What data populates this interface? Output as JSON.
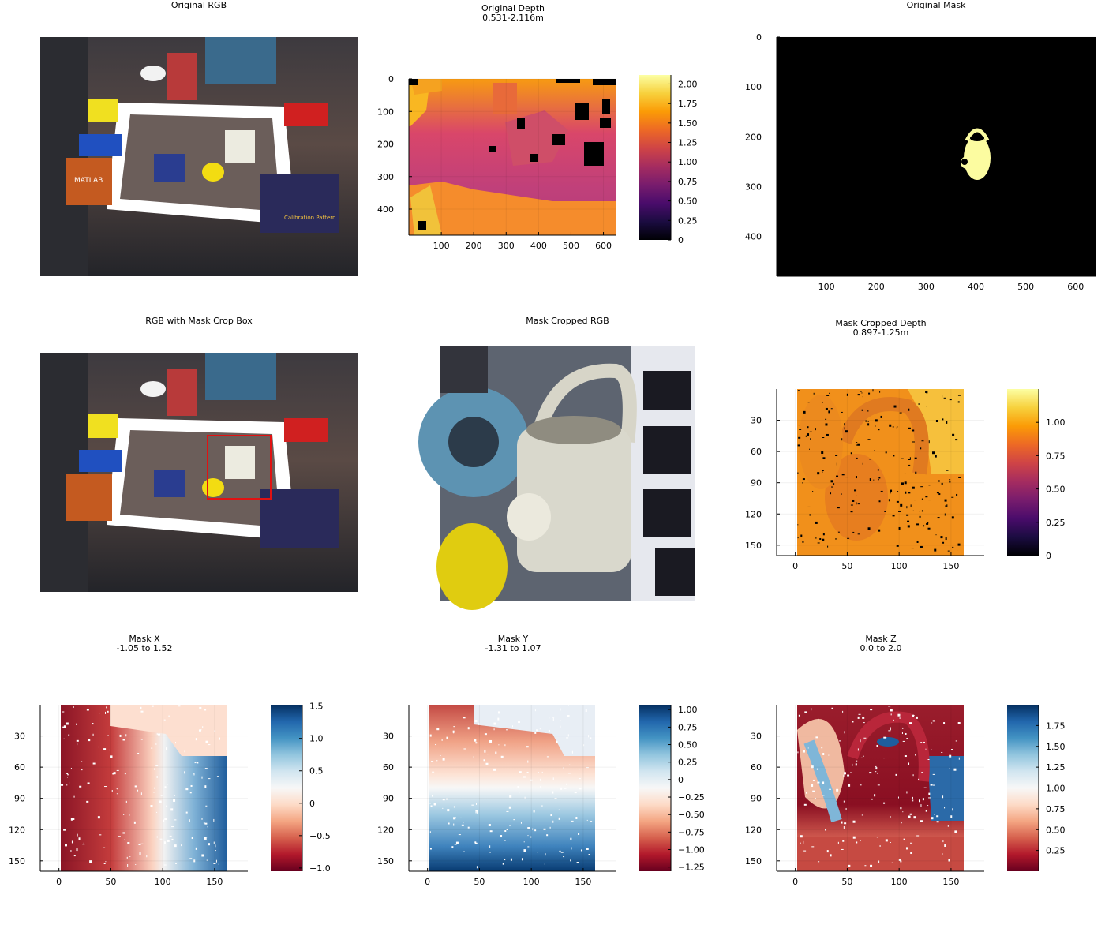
{
  "colors": {
    "crop_box": "#e11212",
    "mask_fg": "#fcfca0",
    "mask_bg": "#000000",
    "missing_depth": "#000000",
    "missing_xyz": "#ffffff"
  },
  "colormaps": {
    "inferno": [
      "#000004",
      "#1b0c41",
      "#4a0c6b",
      "#781c6d",
      "#a52c60",
      "#cf4446",
      "#ed6925",
      "#fb9b06",
      "#f7d13d",
      "#fcffa4"
    ],
    "rdbu": [
      "#67001f",
      "#b2182b",
      "#d6604d",
      "#f4a582",
      "#fddbc7",
      "#f7f7f7",
      "#d1e5f0",
      "#92c5de",
      "#4393c3",
      "#2166ac",
      "#053061"
    ]
  },
  "panels": {
    "original_rgb": {
      "title": "Original RGB"
    },
    "original_depth": {
      "title": "Original Depth",
      "subtitle": "0.531-2.116m"
    },
    "original_mask": {
      "title": "Original Mask"
    },
    "rgb_crop_box": {
      "title": "RGB with Mask Crop Box"
    },
    "mask_cropped_rgb": {
      "title": "Mask Cropped RGB"
    },
    "mask_cropped_depth": {
      "title": "Mask Cropped Depth",
      "subtitle": "0.897-1.25m"
    },
    "mask_x": {
      "title": "Mask X",
      "subtitle": "-1.05 to 1.52"
    },
    "mask_y": {
      "title": "Mask Y",
      "subtitle": "-1.31 to 1.07"
    },
    "mask_z": {
      "title": "Mask Z",
      "subtitle": "0.0 to 2.0"
    }
  },
  "scene_labels": {
    "poster": "MATLAB",
    "book": "Calibration Pattern"
  },
  "chart_data": [
    {
      "type": "image",
      "name": "Original RGB",
      "title": "Original RGB",
      "width": 640,
      "height": 480
    },
    {
      "type": "heatmap",
      "title": "Original Depth",
      "subtitle": "0.531-2.116m",
      "xlim": [
        0,
        640
      ],
      "ylim": [
        0,
        480
      ],
      "xticks": [
        100,
        200,
        300,
        400,
        500,
        600
      ],
      "yticks": [
        0,
        100,
        200,
        300,
        400
      ],
      "colorbar": {
        "colormap": "inferno",
        "range": [
          0,
          2.116
        ],
        "ticks": [
          0,
          0.25,
          0.5,
          0.75,
          1.0,
          1.25,
          1.5,
          1.75,
          2.0
        ],
        "tick_labels": [
          "0",
          "0.25",
          "0.50",
          "0.75",
          "1.00",
          "1.25",
          "1.50",
          "1.75",
          "2.00"
        ]
      },
      "value_range": [
        0.531,
        2.116
      ]
    },
    {
      "type": "heatmap",
      "title": "Original Mask",
      "xlim": [
        0,
        640
      ],
      "ylim": [
        0,
        480
      ],
      "xticks": [
        100,
        200,
        300,
        400,
        500,
        600
      ],
      "yticks": [
        0,
        100,
        200,
        300,
        400
      ],
      "mask_object_bbox": {
        "x": [
          375,
          430
        ],
        "y": [
          175,
          285
        ]
      }
    },
    {
      "type": "image",
      "title": "RGB with Mask Crop Box",
      "crop_box_pixels": {
        "x": [
          337,
          462
        ],
        "y": [
          172,
          290
        ]
      }
    },
    {
      "type": "image",
      "title": "Mask Cropped RGB",
      "width": 160,
      "height": 160
    },
    {
      "type": "heatmap",
      "title": "Mask Cropped Depth",
      "subtitle": "0.897-1.25m",
      "xlim": [
        -18,
        182
      ],
      "ylim": [
        0,
        160
      ],
      "xticks": [
        0,
        50,
        100,
        150
      ],
      "yticks": [
        30,
        60,
        90,
        120,
        150
      ],
      "colorbar": {
        "colormap": "inferno",
        "range": [
          0,
          1.25
        ],
        "ticks": [
          0,
          0.25,
          0.5,
          0.75,
          1.0
        ],
        "tick_labels": [
          "0",
          "0.25",
          "0.50",
          "0.75",
          "1.00"
        ]
      },
      "value_range": [
        0.897,
        1.25
      ]
    },
    {
      "type": "heatmap",
      "title": "Mask X",
      "subtitle": "-1.05 to 1.52",
      "xlim": [
        -18,
        182
      ],
      "ylim": [
        0,
        160
      ],
      "xticks": [
        0,
        50,
        100,
        150
      ],
      "yticks": [
        30,
        60,
        90,
        120,
        150
      ],
      "colorbar": {
        "colormap": "rdbu",
        "range": [
          -1.05,
          1.52
        ],
        "ticks": [
          -1.0,
          -0.5,
          0,
          0.5,
          1.0,
          1.5
        ],
        "tick_labels": [
          "−1.0",
          "−0.5",
          "0",
          "0.5",
          "1.0",
          "1.5"
        ]
      },
      "value_range": [
        -1.05,
        1.52
      ]
    },
    {
      "type": "heatmap",
      "title": "Mask Y",
      "subtitle": "-1.31 to 1.07",
      "xlim": [
        -18,
        182
      ],
      "ylim": [
        0,
        160
      ],
      "xticks": [
        0,
        50,
        100,
        150
      ],
      "yticks": [
        30,
        60,
        90,
        120,
        150
      ],
      "colorbar": {
        "colormap": "rdbu",
        "range": [
          -1.31,
          1.07
        ],
        "ticks": [
          -1.25,
          -1.0,
          -0.75,
          -0.5,
          -0.25,
          0,
          0.25,
          0.5,
          0.75,
          1.0
        ],
        "tick_labels": [
          "−1.25",
          "−1.00",
          "−0.75",
          "−0.50",
          "−0.25",
          "0",
          "0.25",
          "0.50",
          "0.75",
          "1.00"
        ]
      },
      "value_range": [
        -1.31,
        1.07
      ]
    },
    {
      "type": "heatmap",
      "title": "Mask Z",
      "subtitle": "0.0 to 2.0",
      "xlim": [
        -18,
        182
      ],
      "ylim": [
        0,
        160
      ],
      "xticks": [
        0,
        50,
        100,
        150
      ],
      "yticks": [
        30,
        60,
        90,
        120,
        150
      ],
      "colorbar": {
        "colormap": "rdbu",
        "range": [
          0,
          2.0
        ],
        "ticks": [
          0.25,
          0.5,
          0.75,
          1.0,
          1.25,
          1.5,
          1.75
        ],
        "tick_labels": [
          "0.25",
          "0.50",
          "0.75",
          "1.00",
          "1.25",
          "1.50",
          "1.75"
        ]
      },
      "value_range": [
        0.0,
        2.0
      ]
    }
  ]
}
